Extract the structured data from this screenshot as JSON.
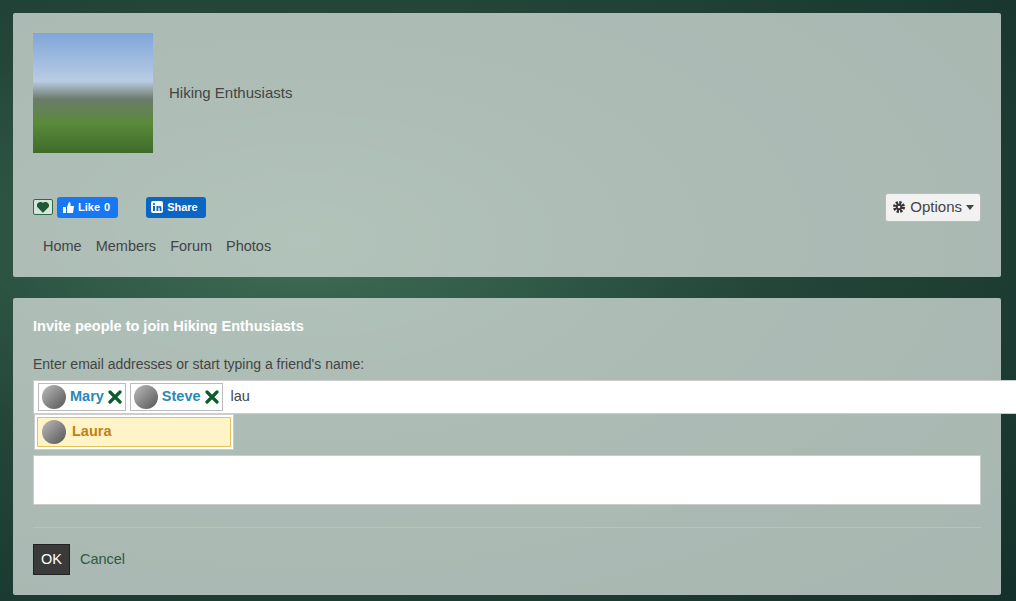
{
  "group": {
    "name": "Hiking Enthusiasts"
  },
  "social": {
    "favorite": true,
    "like_label": "Like",
    "like_count": "0",
    "share_label": "Share"
  },
  "options_label": "Options",
  "tabs": [
    {
      "label": "Home",
      "selected": false
    },
    {
      "label": "Members",
      "selected": false
    },
    {
      "label": "Forum",
      "selected": false
    },
    {
      "label": "Photos",
      "selected": false
    }
  ],
  "invite": {
    "title": "Invite people to join Hiking Enthusiasts",
    "prompt": "Enter email addresses or start typing a friend's name:",
    "tokens": [
      {
        "name": "Mary"
      },
      {
        "name": "Steve"
      }
    ],
    "query": "lau",
    "suggestions": [
      {
        "name": "Laura",
        "selected": true
      }
    ],
    "message": ""
  },
  "buttons": {
    "ok": "OK",
    "cancel": "Cancel"
  }
}
